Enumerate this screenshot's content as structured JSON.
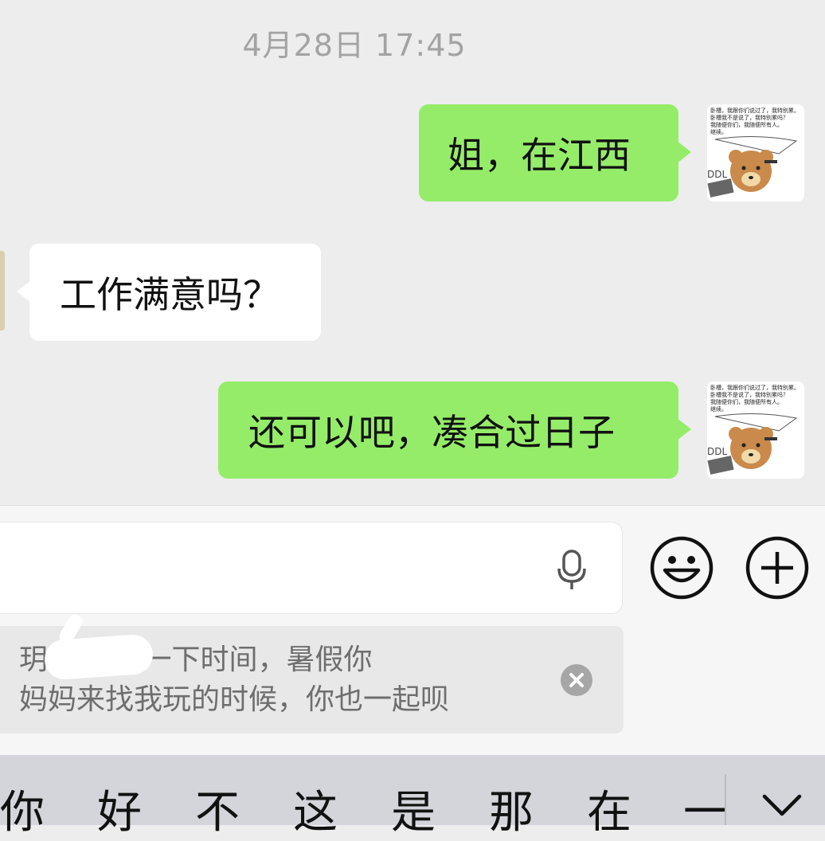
{
  "chat": {
    "timestamp": "4月28日 17:45",
    "messages": [
      {
        "side": "right",
        "text": "姐，在江西"
      },
      {
        "side": "left",
        "text": "工作满意吗？"
      },
      {
        "side": "right",
        "text": "还可以吧，凑合过日子"
      }
    ],
    "sticker_caption": "卧槽，我跟你们说过了，我特别累。卧槽我不是说了，我特别累吗？我随便你们，我随便所有人。继续。"
  },
  "input": {
    "value": "",
    "mic_icon": "microphone-icon",
    "emoji_icon": "smiley-icon",
    "plus_icon": "plus-circle-icon"
  },
  "quote": {
    "text_line1": "玥        ：安排一下时间，暑假你",
    "text_line2": "妈妈来找我玩的时候，你也一起呗",
    "close_icon": "close-circle-icon"
  },
  "keyboard": {
    "candidates": [
      "你",
      "好",
      "不",
      "这",
      "是",
      "那",
      "在",
      "一"
    ],
    "collapse_icon": "chevron-down-icon"
  },
  "colors": {
    "background": "#ededed",
    "green_bubble": "#95ec69",
    "white_bubble": "#ffffff"
  }
}
